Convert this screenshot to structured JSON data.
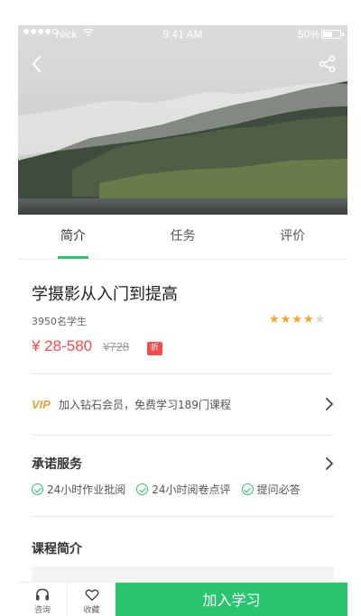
{
  "status_bar": {
    "carrier": "Nick",
    "time": "9:41 AM",
    "battery": "50%"
  },
  "hero": {
    "back_icon": "chevron-left-icon",
    "share_icon": "share-icon"
  },
  "tabs": [
    {
      "label": "简介",
      "active": true
    },
    {
      "label": "任务",
      "active": false
    },
    {
      "label": "评价",
      "active": false
    }
  ],
  "course": {
    "title": "学摄影从入门到提高",
    "students": "3950名学生",
    "rating": 4,
    "rating_max": 5,
    "price": "¥ 28-580",
    "old_price": "¥728",
    "badge": "折"
  },
  "vip": {
    "logo": "VIP",
    "text": "加入钻石会员，免费学习189门课程"
  },
  "promise": {
    "title": "承诺服务",
    "items": [
      "24小时作业批阅",
      "24小时阅卷点评",
      "提问必答"
    ]
  },
  "intro": {
    "title": "课程简介"
  },
  "bottom_bar": {
    "consult_label": "咨询",
    "favorite_label": "收藏",
    "join_label": "加入学习"
  },
  "colors": {
    "accent": "#2bc46f",
    "price": "#f44b4b",
    "star": "#f5a623",
    "vip": "#e3a53a"
  }
}
